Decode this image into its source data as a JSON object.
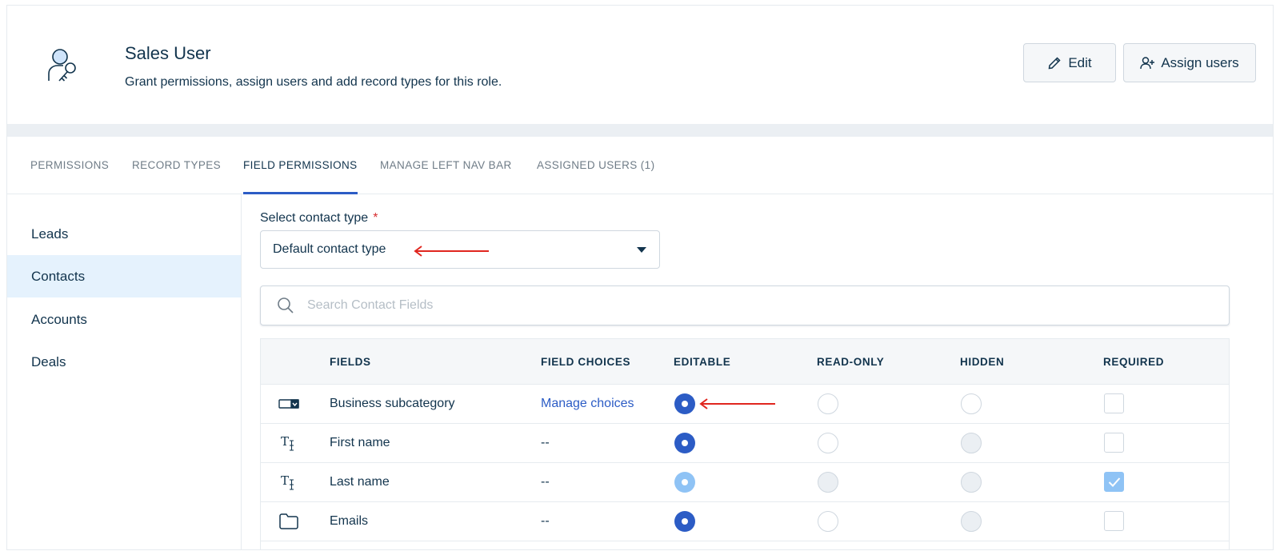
{
  "header": {
    "title": "Sales User",
    "description": "Grant permissions, assign users and add record types for this role.",
    "edit_label": "Edit",
    "assign_label": "Assign users",
    "icon": "user-key-icon"
  },
  "tabs": [
    {
      "label": "PERMISSIONS",
      "active": false
    },
    {
      "label": "RECORD TYPES",
      "active": false
    },
    {
      "label": "FIELD PERMISSIONS",
      "active": true
    },
    {
      "label": "MANAGE LEFT NAV BAR",
      "active": false
    },
    {
      "label": "ASSIGNED USERS (1)",
      "active": false
    }
  ],
  "leftnav": {
    "items": [
      {
        "label": "Leads",
        "active": false
      },
      {
        "label": "Contacts",
        "active": true
      },
      {
        "label": "Accounts",
        "active": false
      },
      {
        "label": "Deals",
        "active": false
      }
    ]
  },
  "contact_type": {
    "label": "Select contact type",
    "required_mark": "*",
    "value": "Default contact type"
  },
  "search": {
    "placeholder": "Search Contact Fields",
    "value": ""
  },
  "table": {
    "headers": [
      "FIELDS",
      "FIELD CHOICES",
      "EDITABLE",
      "READ-ONLY",
      "HIDDEN",
      "REQUIRED"
    ],
    "rows": [
      {
        "icon": "dropdown-field-icon",
        "field": "Business subcategory",
        "choices": "Manage choices",
        "choices_is_link": true,
        "editable": "selected",
        "readonly": "unselected",
        "hidden": "unselected",
        "required": "unchecked"
      },
      {
        "icon": "text-field-icon",
        "field": "First name",
        "choices": "--",
        "choices_is_link": false,
        "editable": "selected",
        "readonly": "unselected",
        "hidden": "disabled",
        "required": "unchecked"
      },
      {
        "icon": "text-field-icon",
        "field": "Last name",
        "choices": "--",
        "choices_is_link": false,
        "editable": "selected-disabled",
        "readonly": "disabled",
        "hidden": "disabled",
        "required": "checked-disabled"
      },
      {
        "icon": "folder-icon",
        "field": "Emails",
        "choices": "--",
        "choices_is_link": false,
        "editable": "selected",
        "readonly": "unselected",
        "hidden": "disabled",
        "required": "unchecked"
      }
    ]
  },
  "colors": {
    "accent": "#2c5cc5",
    "annotation_arrow": "#e0261f",
    "active_nav_bg": "#e5f2fd"
  }
}
